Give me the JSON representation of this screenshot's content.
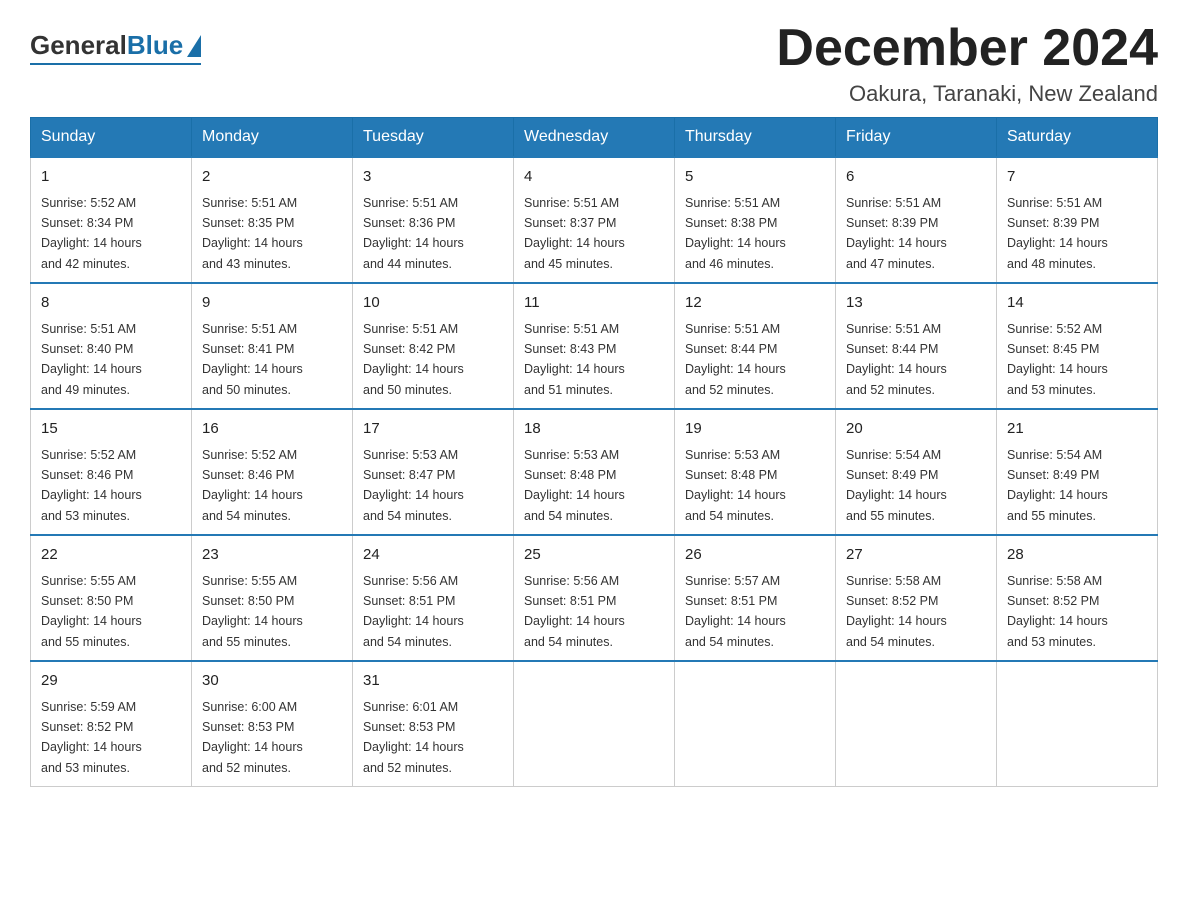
{
  "header": {
    "logo_general": "General",
    "logo_blue": "Blue",
    "month_title": "December 2024",
    "location": "Oakura, Taranaki, New Zealand"
  },
  "days_of_week": [
    "Sunday",
    "Monday",
    "Tuesday",
    "Wednesday",
    "Thursday",
    "Friday",
    "Saturday"
  ],
  "weeks": [
    [
      {
        "day": "1",
        "sunrise": "5:52 AM",
        "sunset": "8:34 PM",
        "daylight": "14 hours and 42 minutes."
      },
      {
        "day": "2",
        "sunrise": "5:51 AM",
        "sunset": "8:35 PM",
        "daylight": "14 hours and 43 minutes."
      },
      {
        "day": "3",
        "sunrise": "5:51 AM",
        "sunset": "8:36 PM",
        "daylight": "14 hours and 44 minutes."
      },
      {
        "day": "4",
        "sunrise": "5:51 AM",
        "sunset": "8:37 PM",
        "daylight": "14 hours and 45 minutes."
      },
      {
        "day": "5",
        "sunrise": "5:51 AM",
        "sunset": "8:38 PM",
        "daylight": "14 hours and 46 minutes."
      },
      {
        "day": "6",
        "sunrise": "5:51 AM",
        "sunset": "8:39 PM",
        "daylight": "14 hours and 47 minutes."
      },
      {
        "day": "7",
        "sunrise": "5:51 AM",
        "sunset": "8:39 PM",
        "daylight": "14 hours and 48 minutes."
      }
    ],
    [
      {
        "day": "8",
        "sunrise": "5:51 AM",
        "sunset": "8:40 PM",
        "daylight": "14 hours and 49 minutes."
      },
      {
        "day": "9",
        "sunrise": "5:51 AM",
        "sunset": "8:41 PM",
        "daylight": "14 hours and 50 minutes."
      },
      {
        "day": "10",
        "sunrise": "5:51 AM",
        "sunset": "8:42 PM",
        "daylight": "14 hours and 50 minutes."
      },
      {
        "day": "11",
        "sunrise": "5:51 AM",
        "sunset": "8:43 PM",
        "daylight": "14 hours and 51 minutes."
      },
      {
        "day": "12",
        "sunrise": "5:51 AM",
        "sunset": "8:44 PM",
        "daylight": "14 hours and 52 minutes."
      },
      {
        "day": "13",
        "sunrise": "5:51 AM",
        "sunset": "8:44 PM",
        "daylight": "14 hours and 52 minutes."
      },
      {
        "day": "14",
        "sunrise": "5:52 AM",
        "sunset": "8:45 PM",
        "daylight": "14 hours and 53 minutes."
      }
    ],
    [
      {
        "day": "15",
        "sunrise": "5:52 AM",
        "sunset": "8:46 PM",
        "daylight": "14 hours and 53 minutes."
      },
      {
        "day": "16",
        "sunrise": "5:52 AM",
        "sunset": "8:46 PM",
        "daylight": "14 hours and 54 minutes."
      },
      {
        "day": "17",
        "sunrise": "5:53 AM",
        "sunset": "8:47 PM",
        "daylight": "14 hours and 54 minutes."
      },
      {
        "day": "18",
        "sunrise": "5:53 AM",
        "sunset": "8:48 PM",
        "daylight": "14 hours and 54 minutes."
      },
      {
        "day": "19",
        "sunrise": "5:53 AM",
        "sunset": "8:48 PM",
        "daylight": "14 hours and 54 minutes."
      },
      {
        "day": "20",
        "sunrise": "5:54 AM",
        "sunset": "8:49 PM",
        "daylight": "14 hours and 55 minutes."
      },
      {
        "day": "21",
        "sunrise": "5:54 AM",
        "sunset": "8:49 PM",
        "daylight": "14 hours and 55 minutes."
      }
    ],
    [
      {
        "day": "22",
        "sunrise": "5:55 AM",
        "sunset": "8:50 PM",
        "daylight": "14 hours and 55 minutes."
      },
      {
        "day": "23",
        "sunrise": "5:55 AM",
        "sunset": "8:50 PM",
        "daylight": "14 hours and 55 minutes."
      },
      {
        "day": "24",
        "sunrise": "5:56 AM",
        "sunset": "8:51 PM",
        "daylight": "14 hours and 54 minutes."
      },
      {
        "day": "25",
        "sunrise": "5:56 AM",
        "sunset": "8:51 PM",
        "daylight": "14 hours and 54 minutes."
      },
      {
        "day": "26",
        "sunrise": "5:57 AM",
        "sunset": "8:51 PM",
        "daylight": "14 hours and 54 minutes."
      },
      {
        "day": "27",
        "sunrise": "5:58 AM",
        "sunset": "8:52 PM",
        "daylight": "14 hours and 54 minutes."
      },
      {
        "day": "28",
        "sunrise": "5:58 AM",
        "sunset": "8:52 PM",
        "daylight": "14 hours and 53 minutes."
      }
    ],
    [
      {
        "day": "29",
        "sunrise": "5:59 AM",
        "sunset": "8:52 PM",
        "daylight": "14 hours and 53 minutes."
      },
      {
        "day": "30",
        "sunrise": "6:00 AM",
        "sunset": "8:53 PM",
        "daylight": "14 hours and 52 minutes."
      },
      {
        "day": "31",
        "sunrise": "6:01 AM",
        "sunset": "8:53 PM",
        "daylight": "14 hours and 52 minutes."
      },
      null,
      null,
      null,
      null
    ]
  ],
  "sunrise_label": "Sunrise:",
  "sunset_label": "Sunset:",
  "daylight_label": "Daylight:"
}
